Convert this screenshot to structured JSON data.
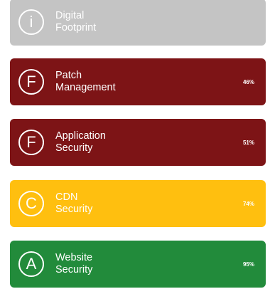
{
  "cards": [
    {
      "grade": "i",
      "title_line1": "Digital",
      "title_line2": "Footprint",
      "score": "",
      "color": "#c4c4c4"
    },
    {
      "grade": "F",
      "title_line1": "Patch",
      "title_line2": "Management",
      "score": "46%",
      "color": "#7d1416"
    },
    {
      "grade": "F",
      "title_line1": "Application",
      "title_line2": "Security",
      "score": "51%",
      "color": "#7d1416"
    },
    {
      "grade": "C",
      "title_line1": "CDN",
      "title_line2": "Security",
      "score": "74%",
      "color": "#ffbf0f"
    },
    {
      "grade": "A",
      "title_line1": "Website",
      "title_line2": "Security",
      "score": "95%",
      "color": "#228b3b"
    }
  ]
}
